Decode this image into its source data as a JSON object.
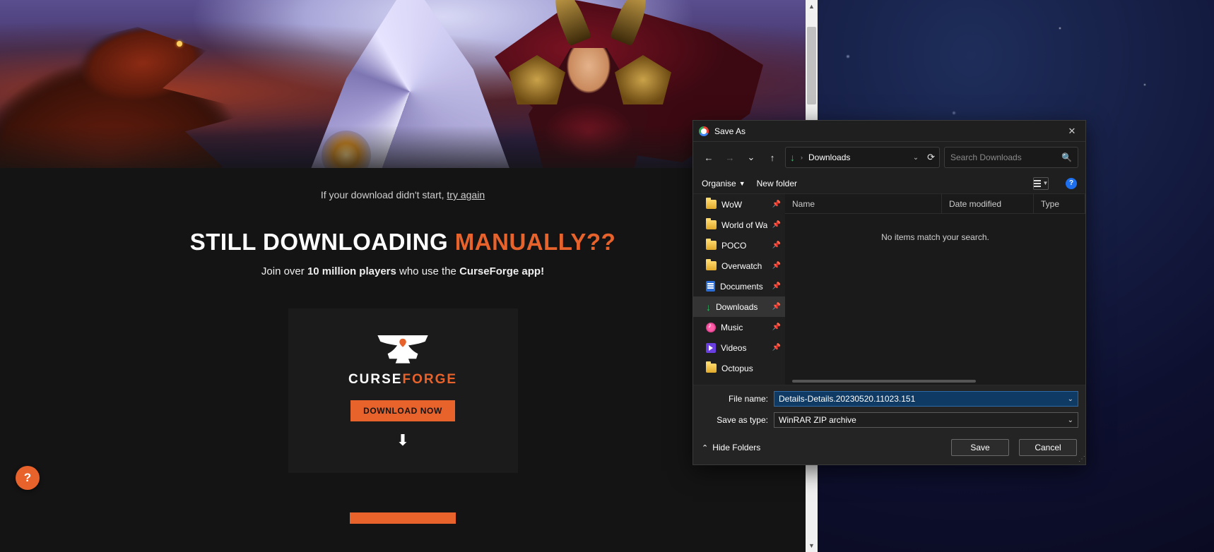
{
  "page": {
    "download_msg_prefix": "If your download didn't start, ",
    "try_again": "try again",
    "headline1": "STILL DOWNLOADING ",
    "headline2": "MANUALLY??",
    "sub_prefix": "Join over ",
    "sub_bold1": "10 million players",
    "sub_mid": " who use the ",
    "sub_bold2": "CurseForge app!",
    "logo_word1": "CURSE",
    "logo_word2": "FORGE",
    "download_now": "DOWNLOAD NOW",
    "help_char": "?"
  },
  "dialog": {
    "title": "Save As",
    "address": "Downloads",
    "search_placeholder": "Search Downloads",
    "toolbar": {
      "organise": "Organise",
      "new_folder": "New folder"
    },
    "help_char": "?",
    "columns": {
      "name": "Name",
      "date": "Date modified",
      "type": "Type"
    },
    "empty": "No items match your search.",
    "nav": [
      {
        "label": "WoW",
        "icon": "folder",
        "pin": true
      },
      {
        "label": "World of War",
        "icon": "folder",
        "pin": true
      },
      {
        "label": "POCO",
        "icon": "folder",
        "pin": true
      },
      {
        "label": "Overwatch",
        "icon": "folder",
        "pin": true
      },
      {
        "label": "Documents",
        "icon": "doc",
        "pin": true
      },
      {
        "label": "Downloads",
        "icon": "dl",
        "pin": true,
        "selected": true
      },
      {
        "label": "Music",
        "icon": "music",
        "pin": true
      },
      {
        "label": "Videos",
        "icon": "vid",
        "pin": true
      },
      {
        "label": "Octopus",
        "icon": "folder",
        "pin": false
      }
    ],
    "labels": {
      "filename": "File name:",
      "saveastype": "Save as type:"
    },
    "filename": "Details-Details.20230520.11023.151",
    "saveastype": "WinRAR ZIP archive",
    "hide_folders": "Hide Folders",
    "save": "Save",
    "cancel": "Cancel"
  }
}
